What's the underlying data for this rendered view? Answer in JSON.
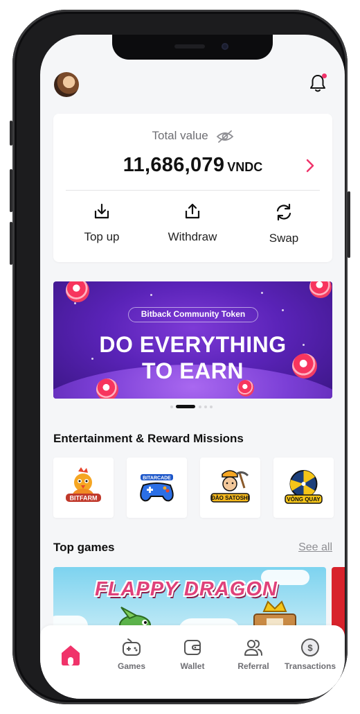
{
  "colors": {
    "accent": "#f0336a",
    "text": "#111111",
    "muted": "#6e6e73",
    "background": "#f5f6f8"
  },
  "header": {
    "avatar_icon": "user-avatar",
    "notification_icon": "bell-icon"
  },
  "wallet": {
    "total_value_label": "Total value",
    "amount": "11,686,079",
    "currency": "VNDC",
    "actions": [
      {
        "label": "Top up",
        "icon": "download-tray-icon"
      },
      {
        "label": "Withdraw",
        "icon": "upload-tray-icon"
      },
      {
        "label": "Swap",
        "icon": "swap-arrows-icon"
      }
    ]
  },
  "banner": {
    "tag": "Bitback Community Token",
    "headline_line1": "DO EVERYTHING",
    "headline_line2": "TO EARN",
    "slide_count": 5,
    "active_slide": 2
  },
  "missions": {
    "title": "Entertainment & Reward Missions",
    "items": [
      {
        "name": "BITFARM",
        "icon": "rooster-logo"
      },
      {
        "name": "BITARCADE",
        "icon": "gamepad-logo"
      },
      {
        "name": "ĐÀO SATOSHI",
        "icon": "miner-logo"
      },
      {
        "name": "VÒNG QUAY",
        "icon": "spin-wheel-logo"
      }
    ]
  },
  "top_games": {
    "title": "Top games",
    "see_all": "See all",
    "featured": {
      "name": "FLAPPY DRAGON"
    }
  },
  "tabbar": {
    "items": [
      {
        "label": "",
        "icon": "home-icon",
        "active": true
      },
      {
        "label": "Games",
        "icon": "gamepad-icon"
      },
      {
        "label": "Wallet",
        "icon": "wallet-icon"
      },
      {
        "label": "Referral",
        "icon": "users-icon"
      },
      {
        "label": "Transactions",
        "icon": "dollar-coin-icon"
      }
    ]
  }
}
